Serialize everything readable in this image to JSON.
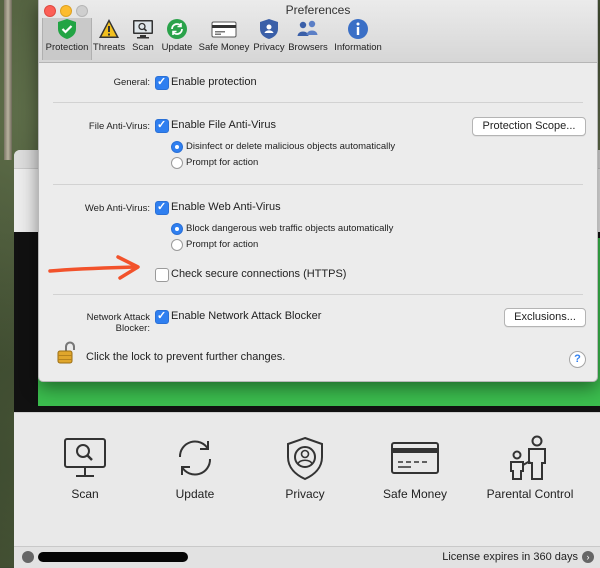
{
  "preferences": {
    "window_title": "Preferences",
    "tabs": [
      {
        "label": "Protection",
        "icon": "shield-check-icon",
        "selected": true
      },
      {
        "label": "Threats",
        "icon": "warning-triangle-icon"
      },
      {
        "label": "Scan",
        "icon": "scan-monitor-icon"
      },
      {
        "label": "Update",
        "icon": "update-arrows-icon"
      },
      {
        "label": "Safe Money",
        "icon": "credit-card-icon"
      },
      {
        "label": "Privacy",
        "icon": "privacy-shield-icon"
      },
      {
        "label": "Browsers",
        "icon": "browsers-people-icon"
      },
      {
        "label": "Information",
        "icon": "info-icon"
      }
    ],
    "general": {
      "label": "General:",
      "enable_protection": {
        "text": "Enable protection",
        "checked": true
      }
    },
    "file_antivirus": {
      "label": "File Anti-Virus:",
      "enable": {
        "text": "Enable File Anti-Virus",
        "checked": true
      },
      "options": [
        {
          "text": "Disinfect or delete malicious objects automatically",
          "selected": true
        },
        {
          "text": "Prompt for action",
          "selected": false
        }
      ],
      "scope_button": "Protection Scope..."
    },
    "web_antivirus": {
      "label": "Web Anti-Virus:",
      "enable": {
        "text": "Enable Web Anti-Virus",
        "checked": true
      },
      "options": [
        {
          "text": "Block dangerous web traffic objects automatically",
          "selected": true
        },
        {
          "text": "Prompt for action",
          "selected": false
        }
      ],
      "https": {
        "text": "Check secure connections (HTTPS)",
        "checked": false
      }
    },
    "network_blocker": {
      "label_line1": "Network Attack",
      "label_line2": "Blocker:",
      "enable": {
        "text": "Enable Network Attack Blocker",
        "checked": true
      },
      "exclusions_button": "Exclusions..."
    },
    "lock_text": "Click the lock to prevent further changes.",
    "help": "?"
  },
  "main_app": {
    "dock_items": [
      {
        "label": "Scan",
        "icon": "scan-monitor-icon"
      },
      {
        "label": "Update",
        "icon": "update-arrows-icon"
      },
      {
        "label": "Privacy",
        "icon": "privacy-shield-icon"
      },
      {
        "label": "Safe Money",
        "icon": "credit-card-icon"
      },
      {
        "label": "Parental Control",
        "icon": "parental-control-icon"
      }
    ],
    "status": {
      "license": "License expires in 360 days"
    }
  },
  "colors": {
    "accent_blue": "#2f7ff0",
    "annotation_arrow": "#f2522b",
    "app_green": "#3bbd4e"
  }
}
